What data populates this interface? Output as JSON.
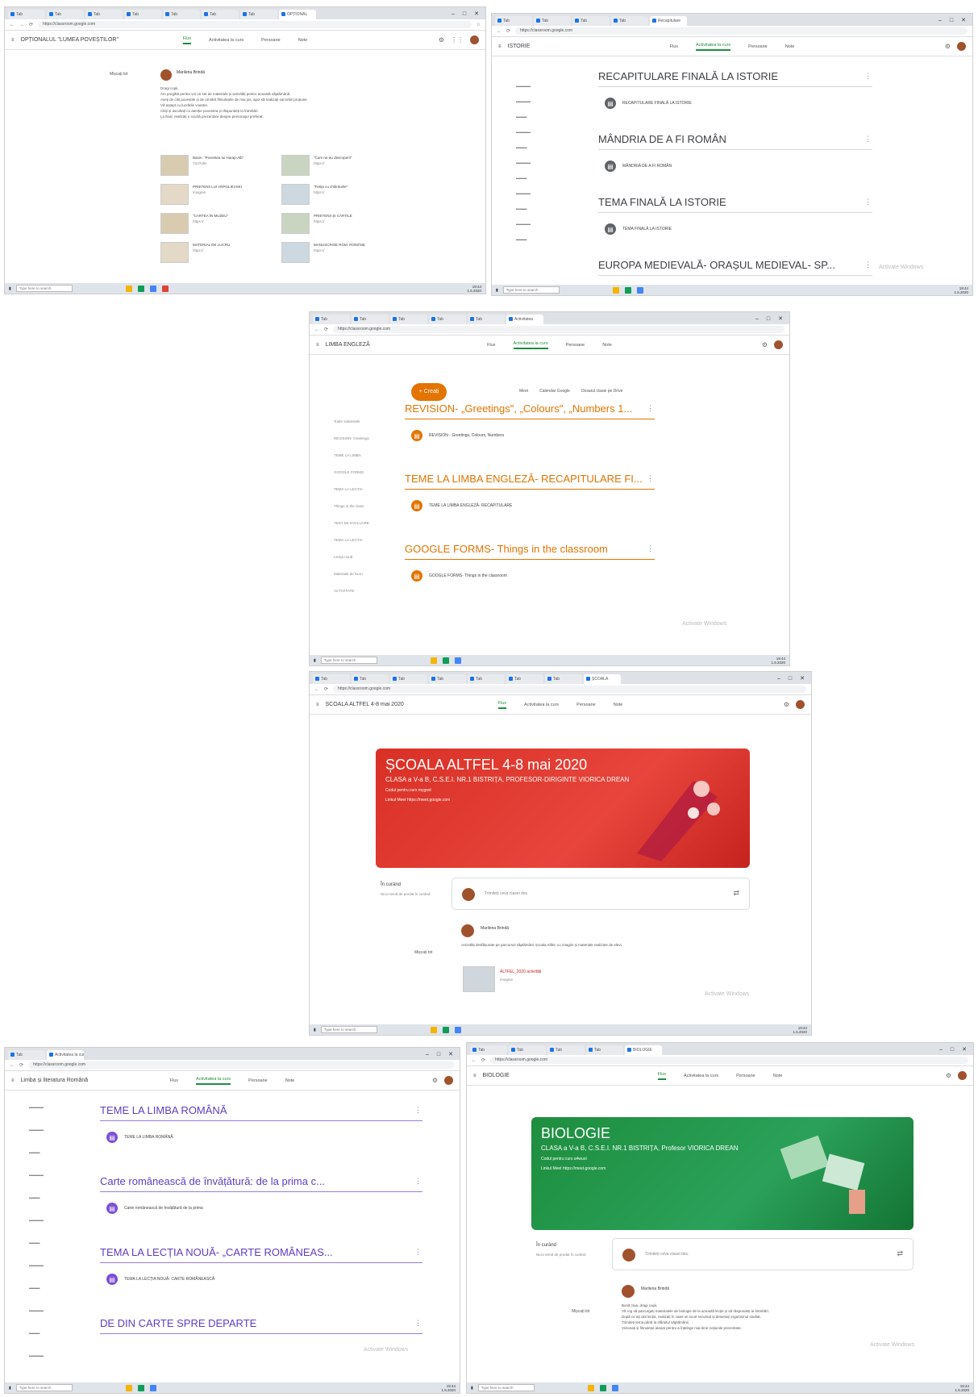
{
  "shots": {
    "s1": {
      "tabs": [
        "Tab",
        "Tab",
        "Tab",
        "Tab",
        "Tab",
        "Tab",
        "Tab",
        "OPȚIONAL"
      ],
      "url": "https://classroom.google.com",
      "class_title": "OPȚIONALUL \"LUMEA POVEȘTILOR\"",
      "nav": [
        "Flux",
        "Activitatea la curs",
        "Persoane",
        "Note"
      ],
      "side_label": "Mișcați tot",
      "author": "Marilena Brindă",
      "post_lines": [
        "Dragi copii,",
        "Am pregătit pentru voi un set de materiale și activități pentru această săptămână.",
        "Aveți de citit poveștile și de urmărit filmulețele de mai jos, apoi să realizați sarcinile propuse.",
        "Vă aștept cu lucrările voastre.",
        "Citiți și ascultați cu atenție povestea și răspundeți la întrebări.",
        "La final, realizați o scurtă prezentare despre personajul preferat."
      ],
      "attachments": [
        {
          "t": "Basm: \"Povestea lui Harap-Alb\"",
          "s": "YouTube"
        },
        {
          "t": "\"Cum ne-au descoperit\"",
          "s": "https://"
        },
        {
          "t": "PRIETENII LUI ARPOLIEVSKI",
          "s": "Imagine"
        },
        {
          "t": "\"Fetița cu chibriturile\"",
          "s": "https://"
        },
        {
          "t": "\"CARTEA ÎN MUZEU\"",
          "s": "https://"
        },
        {
          "t": "PRIETENII ȘI CĂRȚILE",
          "s": "https://"
        },
        {
          "t": "MATERIAL DE LUCRU",
          "s": "https://"
        },
        {
          "t": "MANUSCRISE ROM. ROMÂNE",
          "s": "https://"
        }
      ]
    },
    "s2": {
      "tabs": [
        "Tab",
        "Tab",
        "Tab",
        "Tab",
        "Recapitulare"
      ],
      "url": "https://classroom.google.com",
      "class_title": "ISTORIE",
      "nav": [
        "Flux",
        "Activitatea la curs",
        "Persoane",
        "Note"
      ],
      "topics": [
        {
          "title": "RECAPITULARE FINALĂ LA ISTORIE",
          "item": "RECAPITULARE FINALĂ LA ISTORIE"
        },
        {
          "title": "MÂNDRIA DE A FI ROMÂN",
          "item": "MÂNDRIA DE A FI ROMÂN"
        },
        {
          "title": "TEMA FINALĂ LA ISTORIE",
          "item": "TEMA FINALĂ LA ISTORIE"
        },
        {
          "title": "EUROPA MEDIEVALĂ- ORAȘUL MEDIEVAL- SP...",
          "item": ""
        }
      ],
      "watermark": "Activate Windows"
    },
    "s3": {
      "tabs": [
        "Tab",
        "Tab",
        "Tab",
        "Tab",
        "Tab",
        "Activitatea"
      ],
      "url": "https://classroom.google.com",
      "class_title": "LIMBA ENGLEZĂ",
      "nav": [
        "Flux",
        "Activitatea la curs",
        "Persoane",
        "Note"
      ],
      "create": "+ Creați",
      "tools": [
        "Meet",
        "Calendar Google",
        "Dosarul clasei pe Drive"
      ],
      "topics": [
        {
          "title": "REVISION- „Greetings\", „Colours\", „Numbers 1...",
          "item": "REVISION - Greetings, Colours, Numbers"
        },
        {
          "title": "TEME LA LIMBA ENGLEZĂ- RECAPITULARE FI...",
          "item": "TEME LA LIMBA ENGLEZĂ- RECAPITULARE"
        },
        {
          "title": "GOOGLE FORMS- Things in the classroom",
          "item": "GOOGLE FORMS- Things in the classroom"
        }
      ],
      "side": [
        "Toate subiectele",
        "REVISION- Greetings",
        "TEME LA LIMBA",
        "GOOGLE FORMS",
        "TEMA LA LECȚIA",
        "Things in the class",
        "TEST DE EVALUARE",
        "TEMA LA LECȚIA",
        "Lecția nouă",
        "Materiale de lucru",
        "ACTIVITATE"
      ],
      "watermark": "Activate Windows"
    },
    "s4": {
      "tabs": [
        "Tab",
        "Tab",
        "Tab",
        "Tab",
        "Tab",
        "Tab",
        "Tab",
        "ȘCOALA"
      ],
      "url": "https://classroom.google.com",
      "class_title": "ȘCOALA ALTFEL 4-8 mai 2020",
      "nav": [
        "Flux",
        "Activitatea la curs",
        "Persoane",
        "Note"
      ],
      "banner_title": "ȘCOALA ALTFEL 4-8 mai 2020",
      "banner_sub": "CLASA a V-a B, C.S.E.I. NR.1 BISTRIȚA, PROFESOR-DIRIGINTE VIORICA DREAN",
      "banner_code": "Codul pentru curs  mygwd",
      "banner_link": "Linkul Meet  https://meet.google.com",
      "upcoming": "În curând",
      "upcoming_note": "Nicio temă de predat în curând",
      "share_placeholder": "Trimiteți ceva clasei dvs.",
      "move": "Mișcați tot",
      "author": "Marilena Brindă",
      "post_text": "Activități desfășurate pe parcursul săptămânii Școala Altfel, cu imagini și materiale realizate de elevi.",
      "attach_title": "ALTFEL_2020 activități",
      "attach_sub": "Imagine",
      "watermark": "Activate Windows"
    },
    "s5": {
      "tabs": [
        "Tab",
        "Activitatea la curs"
      ],
      "url": "https://classroom.google.com",
      "class_title": "Limba și literatura Română",
      "nav": [
        "Flux",
        "Activitatea la curs",
        "Persoane",
        "Note"
      ],
      "topics": [
        {
          "title": "TEME LA LIMBA ROMÂNĂ",
          "item": "TEME LA LIMBA ROMÂNĂ"
        },
        {
          "title": "Carte românească de învățătură: de la prima c...",
          "item": "Carte românească de învățătură de la prima"
        },
        {
          "title": "TEMA LA LECȚIA NOUĂ- „CARTE ROMÂNEAS...",
          "item": "TEMA LA LECȚIA NOUĂ- CARTE ROMÂNEASCĂ"
        },
        {
          "title": "DE DIN CARTE SPRE DEPARTE",
          "item": ""
        }
      ],
      "watermark": "Activate Windows"
    },
    "s6": {
      "tabs": [
        "Tab",
        "Tab",
        "Tab",
        "Tab",
        "BIOLOGIE"
      ],
      "url": "https://classroom.google.com",
      "class_title": "BIOLOGIE",
      "nav": [
        "Flux",
        "Activitatea la curs",
        "Persoane",
        "Note"
      ],
      "banner_title": "BIOLOGIE",
      "banner_sub": "CLASA a V-a B, C.S.E.I. NR.1 BISTRIȚA, Profesor VIORICA DREAN",
      "banner_code": "Codul pentru curs  a4wuol",
      "banner_link": "Linkul Meet  https://meet.google.com",
      "upcoming": "În curând",
      "upcoming_note": "Nicio temă de predat în curând",
      "share_placeholder": "Trimiteți ceva clasei dvs.",
      "move": "Mișcați tot",
      "author": "Marilena Brindă",
      "post_lines": [
        "Bună ziua, dragi copii,",
        "Vă rog să parcurgeți materialele de biologie de la această lecție și să răspundeți la întrebări.",
        "După ce ați citit lecția, realizați în caiet un scurt rezumat și desenați organismul studiat.",
        "Trimiteți tema până la sfârșitul săptămânii.",
        "Vizionați și filmulețul atașat pentru a înțelege mai bine noțiunile prezentate."
      ],
      "watermark": "Activate Windows"
    },
    "taskbar": {
      "search": "Type here to search",
      "time": "19:44",
      "date": "1.5.2020"
    }
  }
}
